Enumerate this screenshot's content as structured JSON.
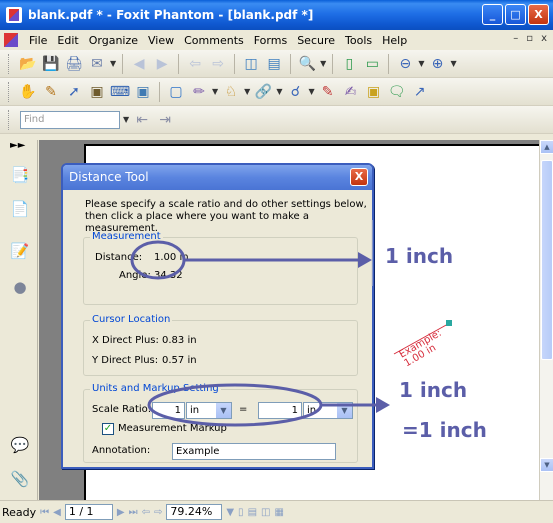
{
  "window": {
    "title": "blank.pdf * - Foxit Phantom - [blank.pdf *]",
    "controls": [
      "_",
      "□",
      "X"
    ]
  },
  "menu": {
    "items": [
      "File",
      "Edit",
      "Organize",
      "View",
      "Comments",
      "Forms",
      "Secure",
      "Tools",
      "Help"
    ],
    "mdi_controls": [
      "–",
      "▫",
      "x"
    ]
  },
  "find": {
    "placeholder": "Find"
  },
  "dialog": {
    "title": "Distance Tool",
    "close": "X",
    "intro": "Please specify a scale ratio and do other settings below, then click a place where you want to make a measurement.",
    "measurement": {
      "label": "Measurement",
      "distance_label": "Distance:",
      "distance_value": "1.00 in",
      "angle_label": "Angle:",
      "angle_value": "34.32"
    },
    "cursor": {
      "label": "Cursor Location",
      "x_label": "X Direct Plus:",
      "x_value": "0.83 in",
      "y_label": "Y Direct Plus:",
      "y_value": "0.57 in"
    },
    "units": {
      "label": "Units and Markup Setting",
      "scale_label": "Scale Ratio:",
      "left_value": "1",
      "left_unit": "in",
      "equals": "=",
      "right_value": "1",
      "right_unit": "in",
      "markup_label": "Measurement Markup",
      "markup_checked": true,
      "annotation_label": "Annotation:",
      "annotation_value": "Example"
    }
  },
  "callouts": {
    "top": "1 inch",
    "bottom_1": "1 inch",
    "bottom_2": "=1 inch",
    "color": "#5b5ea8"
  },
  "stamp": {
    "line1": "Example:",
    "line2": "1.00 in"
  },
  "status": {
    "ready": "Ready",
    "page": "1 / 1",
    "zoom": "79.24%"
  }
}
